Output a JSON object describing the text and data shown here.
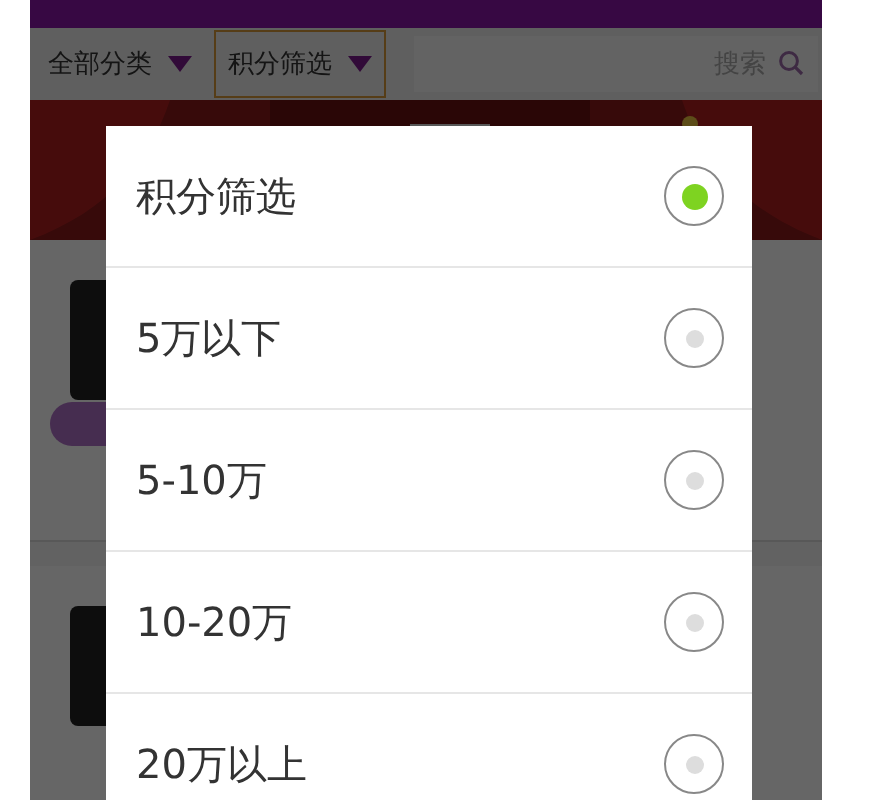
{
  "filter_bar": {
    "filters": [
      {
        "label": "全部分类",
        "selected": false
      },
      {
        "label": "积分筛选",
        "selected": true
      }
    ],
    "search": {
      "placeholder": "搜索"
    }
  },
  "dialog": {
    "options": [
      {
        "label": "积分筛选",
        "selected": true
      },
      {
        "label": "5万以下",
        "selected": false
      },
      {
        "label": "5-10万",
        "selected": false
      },
      {
        "label": "10-20万",
        "selected": false
      },
      {
        "label": "20万以上",
        "selected": false
      }
    ]
  }
}
